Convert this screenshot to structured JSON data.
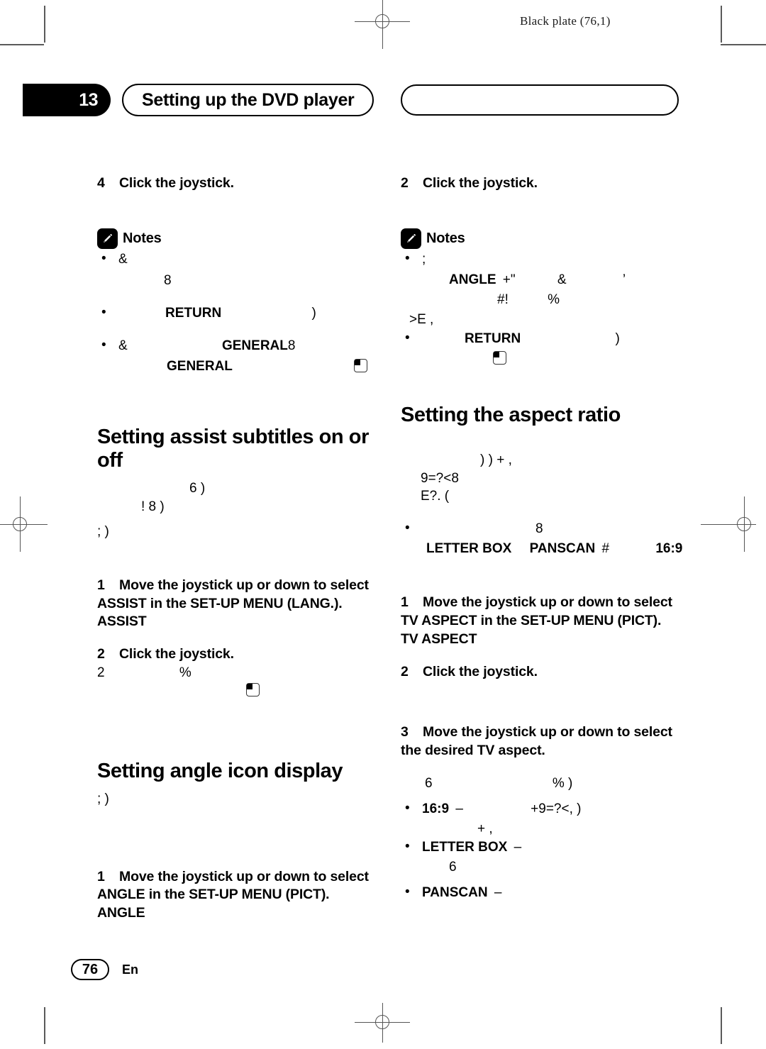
{
  "page": {
    "black_plate": "Black plate (76,1)",
    "chapter_number": "13",
    "chapter_title": "Setting up the DVD player",
    "page_number": "76",
    "language_code": "En"
  },
  "left_column": {
    "step4": {
      "num": "4",
      "text": "Click the joystick."
    },
    "notes_label": "Notes",
    "notes": [
      {
        "line1": "&",
        "line2": "8"
      },
      {
        "line1_pre": "",
        "bold": "RETURN",
        "tail": ")"
      },
      {
        "line1_pre": "&",
        "bold1": "GENERAL",
        "after1": "8",
        "line2_bold": "GENERAL",
        "icon": "stop-icon"
      }
    ],
    "heading_assist": "Setting assist subtitles on or off",
    "assist_body": [
      "6                    )",
      "!     8              )",
      ";                              )"
    ],
    "assist_step1": {
      "num": "1",
      "line1": "Move the joystick up or down to select",
      "line2": "ASSIST in the SET-UP MENU (LANG.).",
      "line3": "ASSIST"
    },
    "assist_step2": {
      "num": "2",
      "text": "Click the joystick.",
      "after1": "2",
      "after2": "%",
      "icon": "stop-icon"
    },
    "heading_angle": "Setting angle icon display",
    "angle_body": [
      ";                              )"
    ],
    "angle_step1": {
      "num": "1",
      "line1": "Move the joystick up or down to select",
      "line2": "ANGLE in the SET-UP MENU (PICT).",
      "line3": "ANGLE"
    }
  },
  "right_column": {
    "step2": {
      "num": "2",
      "text": "Click the joystick."
    },
    "notes_label": "Notes",
    "notes": [
      {
        "line1": ";",
        "line2_bold": "ANGLE",
        "line2_a": "+\"",
        "line2_b": "&",
        "line2_c": "’",
        "line3_a": "#!",
        "line3_b": "%",
        "line4": ">E ,"
      },
      {
        "bold": "RETURN",
        "tail": ")",
        "icon": "stop-icon"
      }
    ],
    "heading_aspect": "Setting the aspect ratio",
    "aspect_body": [
      ")  )              +           ,",
      "9=?<8",
      "E?.  ("
    ],
    "aspect_note": {
      "line1": "8",
      "bold1": "LETTER BOX",
      "bold2": "PANSCAN",
      "mid": "#",
      "bold3": "16:9"
    },
    "aspect_step1": {
      "num": "1",
      "line1": "Move the joystick up or down to select",
      "line2": "TV ASPECT in the SET-UP MENU (PICT).",
      "line3": "TV ASPECT"
    },
    "aspect_step2": {
      "num": "2",
      "text": "Click the joystick."
    },
    "aspect_step3": {
      "num": "3",
      "line1": "Move the joystick up or down to select",
      "line2": "the desired TV aspect."
    },
    "aspect_after3": {
      "a": "6",
      "b": "%  )"
    },
    "aspect_options": [
      {
        "label": "16:9",
        "dash": "–",
        "tail": "+9=?<,         )",
        "sub": "+                 ,"
      },
      {
        "label": "LETTER BOX",
        "dash": "–",
        "sub": "6"
      },
      {
        "label": "PANSCAN",
        "dash": "–",
        "sub": ""
      }
    ]
  }
}
